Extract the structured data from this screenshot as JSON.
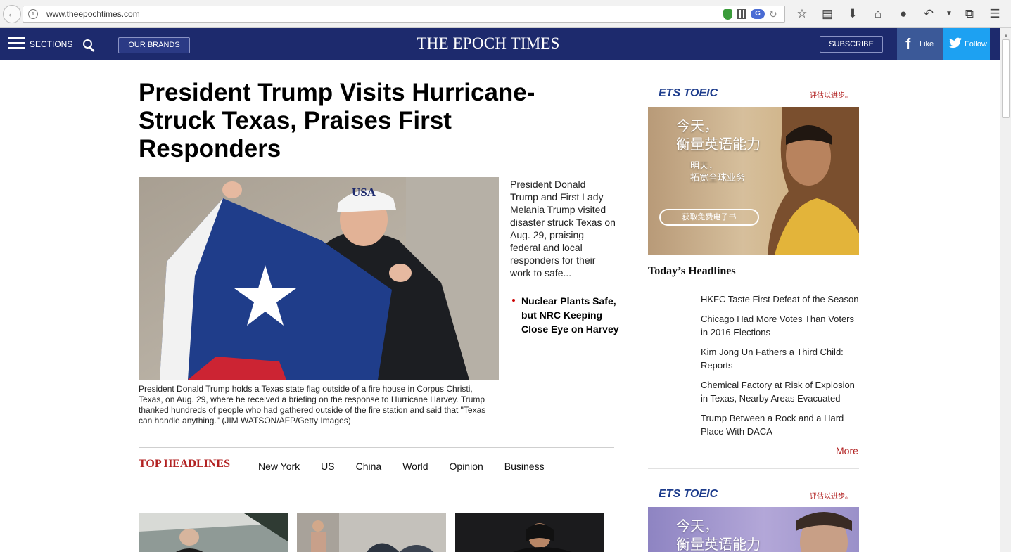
{
  "browser": {
    "url": "www.theepochtimes.com",
    "g_badge": "G"
  },
  "header": {
    "sections_label": "SECTIONS",
    "brands_label": "OUR BRANDS",
    "logo": "THE EPOCH TIMES",
    "subscribe_label": "SUBSCRIBE",
    "facebook_label": "Like",
    "twitter_label": "Follow",
    "facebook_color": "#3b5998",
    "twitter_color": "#1da1f2",
    "header_color": "#1d2a6d"
  },
  "article": {
    "headline": "President Trump Visits Hurricane-Struck Texas, Praises First Responders",
    "cap_text": "USA",
    "summary": "President Donald Trump and First Lady Melania Trump visited disaster struck Texas on Aug. 29, praising federal and local responders for their work to safe...",
    "caption": "President Donald Trump holds a Texas state flag outside of a fire house in Corpus Christi, Texas, on Aug. 29, where he received a briefing on the response to Hurricane Harvey. Trump thanked hundreds of people who had gathered outside of the fire station and said that \"Texas can handle anything.\" (JIM WATSON/AFP/Getty Images)",
    "related": "Nuclear Plants Safe, but NRC Keeping Close Eye on Harvey"
  },
  "top_headlines": {
    "title": "TOP HEADLINES",
    "tabs": [
      "New York",
      "US",
      "China",
      "World",
      "Opinion",
      "Business"
    ],
    "accent": "#b22222"
  },
  "ads": {
    "brand": "ETS TOEIC",
    "tagline": "评估以进步。",
    "line1": "今天，",
    "line2": "衡量英语能力",
    "line3": "明天，",
    "line4": "拓宽全球业务",
    "cta": "获取免费电子书"
  },
  "todays_headlines": {
    "title": "Today’s Headlines",
    "items": [
      "HKFC Taste First Defeat of the Season",
      "Chicago Had More Votes Than Voters in 2016 Elections",
      "Kim Jong Un Fathers a Third Child: Reports",
      "Chemical Factory at Risk of Explosion in Texas, Nearby Areas Evacuated",
      "Trump Between a Rock and a Hard Place With DACA"
    ],
    "more_label": "More"
  }
}
